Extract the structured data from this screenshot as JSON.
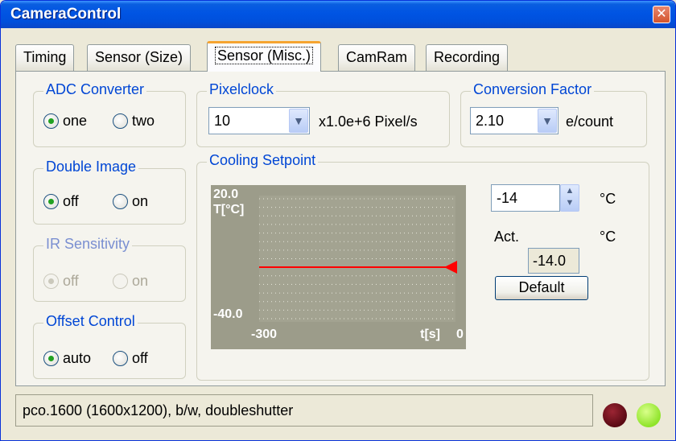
{
  "window": {
    "title": "CameraControl",
    "close_glyph": "✕"
  },
  "tabs": [
    {
      "label": "Timing",
      "active": false
    },
    {
      "label": "Sensor (Size)",
      "active": false
    },
    {
      "label": "Sensor (Misc.)",
      "active": true
    },
    {
      "label": "CamRam",
      "active": false
    },
    {
      "label": "Recording",
      "active": false
    }
  ],
  "adc_converter": {
    "title": "ADC Converter",
    "options": [
      "one",
      "two"
    ],
    "selected": "one"
  },
  "double_image": {
    "title": "Double Image",
    "options": [
      "off",
      "on"
    ],
    "selected": "off"
  },
  "ir_sensitivity": {
    "title": "IR Sensitivity",
    "options": [
      "off",
      "on"
    ],
    "selected": "off",
    "disabled": true
  },
  "offset_control": {
    "title": "Offset Control",
    "options": [
      "auto",
      "off"
    ],
    "selected": "auto"
  },
  "pixelclock": {
    "title": "Pixelclock",
    "value": "10",
    "unit": "x1.0e+6 Pixel/s"
  },
  "conversion_factor": {
    "title": "Conversion Factor",
    "value": "2.10",
    "unit": "e/count"
  },
  "cooling": {
    "title": "Cooling Setpoint",
    "setpoint": "-14",
    "setpoint_unit": "°C",
    "actual_label": "Act.",
    "actual_value": "-14.0",
    "actual_unit": "°C",
    "default_button": "Default"
  },
  "chart_data": {
    "type": "line",
    "y_top_label": "20.0",
    "y_bottom_label": "-40.0",
    "ylabel": "T[°C]",
    "x_left_label": "-300",
    "xlabel": "t[s]",
    "x_right_label": "0",
    "xlim": [
      -300,
      0
    ],
    "ylim": [
      -40,
      20
    ],
    "setpoint": -14,
    "series": [
      {
        "x": [
          -300,
          0
        ],
        "y": [
          -14,
          -14
        ]
      }
    ],
    "colors": {
      "background": "#9c9c8a",
      "plot": "#a3a391",
      "grid": "#e8e8dc",
      "line": "#ff0000"
    }
  },
  "status": {
    "text": "pco.1600 (1600x1200), b/w,  doubleshutter"
  },
  "leds": {
    "red": "#7a1020",
    "green": "#a8f042"
  }
}
